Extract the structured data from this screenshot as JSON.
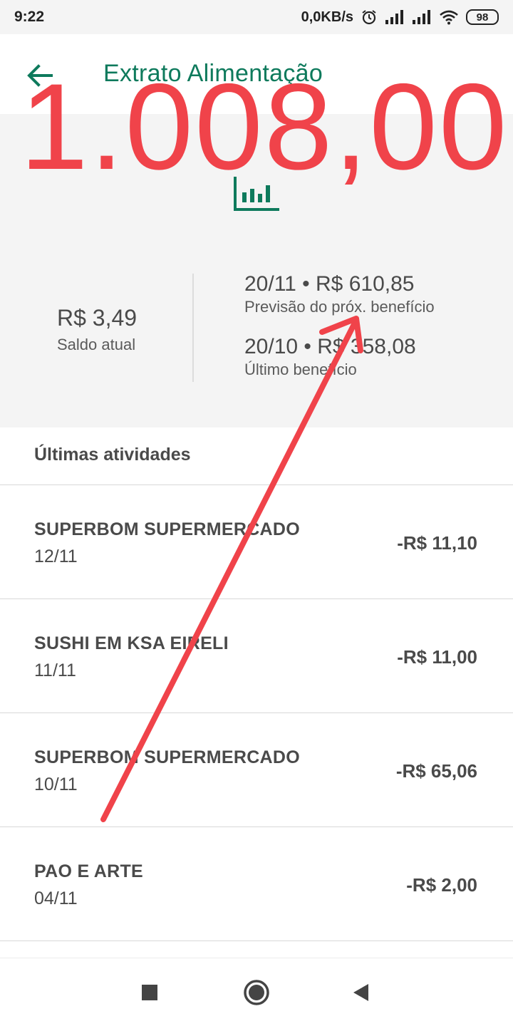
{
  "status_bar": {
    "time": "9:22",
    "net_speed": "0,0KB/s",
    "battery": "98",
    "icons": [
      "alarm-icon",
      "signal-icon",
      "signal-icon",
      "wifi-icon",
      "battery-icon"
    ]
  },
  "header": {
    "title": "Extrato Alimentação",
    "back_icon": "arrow-left-icon"
  },
  "overlay": {
    "total": "1.008,00",
    "color": "#f0434a"
  },
  "summary": {
    "chart_icon": "bar-chart-icon",
    "saldo_value": "R$ 3,49",
    "saldo_label": "Saldo atual",
    "next_benefit_value": "20/11 • R$ 610,85",
    "next_benefit_label": "Previsão do próx. benefício",
    "last_benefit_value": "20/10 • R$ 358,08",
    "last_benefit_label": "Último benefício"
  },
  "activities": {
    "title": "Últimas atividades",
    "items": [
      {
        "name": "SUPERBOM SUPERMERCADO",
        "date": "12/11",
        "amount": "-R$ 11,10"
      },
      {
        "name": "SUSHI EM KSA EIRELI",
        "date": "11/11",
        "amount": "-R$ 11,00"
      },
      {
        "name": "SUPERBOM SUPERMERCADO",
        "date": "10/11",
        "amount": "-R$ 65,06"
      },
      {
        "name": "PAO E ARTE",
        "date": "04/11",
        "amount": "-R$ 2,00"
      }
    ]
  },
  "colors": {
    "brand_green": "#0e7a5c",
    "background_grey": "#f4f4f4",
    "text": "#4a4a4a"
  }
}
